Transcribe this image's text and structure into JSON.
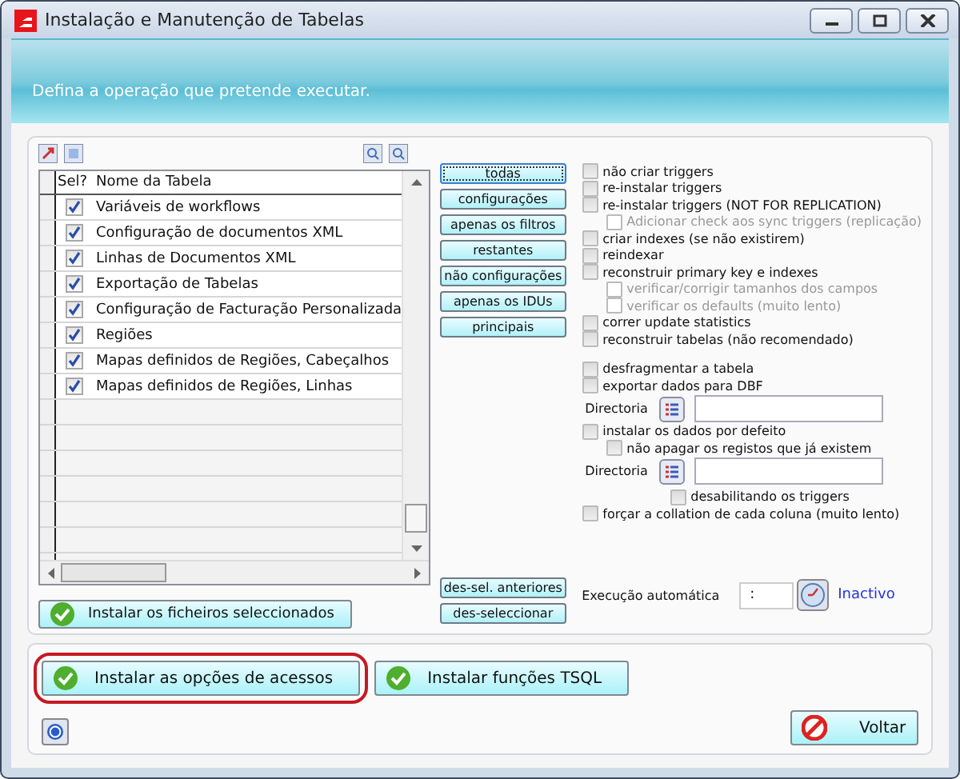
{
  "window": {
    "title": "Instalação e Manutenção de Tabelas"
  },
  "banner": {
    "text": "Defina a operação que pretende executar."
  },
  "table": {
    "columns": [
      "Sel?",
      "Nome da Tabela"
    ],
    "rows": [
      {
        "name": "Variáveis de workflows",
        "checked": true
      },
      {
        "name": "Configuração de documentos XML",
        "checked": true
      },
      {
        "name": "Linhas de Documentos XML",
        "checked": true
      },
      {
        "name": "Exportação de Tabelas",
        "checked": true
      },
      {
        "name": "Configuração de Facturação Personalizada",
        "checked": true
      },
      {
        "name": "Regiões",
        "checked": true
      },
      {
        "name": "Mapas definidos de Regiões, Cabeçalhos",
        "checked": true
      },
      {
        "name": "Mapas definidos de Regiões, Linhas",
        "checked": true
      }
    ]
  },
  "filter_buttons": [
    {
      "label": "todas",
      "focused": true
    },
    {
      "label": "configurações",
      "focused": false
    },
    {
      "label": "apenas os filtros",
      "focused": false
    },
    {
      "label": "restantes",
      "focused": false
    },
    {
      "label": "não configurações",
      "focused": false
    },
    {
      "label": "apenas os IDUs",
      "focused": false
    },
    {
      "label": "principais",
      "focused": false
    }
  ],
  "deselect_buttons": [
    "des-sel. anteriores",
    "des-seleccionar"
  ],
  "option_groups": [
    [
      {
        "kind": "check",
        "label": "não criar triggers",
        "checked": false,
        "disabled": false
      },
      {
        "kind": "check",
        "label": "re-instalar triggers",
        "checked": false,
        "disabled": false
      },
      {
        "kind": "check",
        "label": "re-instalar triggers (NOT FOR REPLICATION)",
        "checked": false,
        "disabled": false
      },
      {
        "kind": "sub",
        "label": "Adicionar check aos sync triggers (replicação)",
        "checked": false,
        "disabled": true
      },
      {
        "kind": "check",
        "label": "criar indexes (se não existirem)",
        "checked": false,
        "disabled": false
      },
      {
        "kind": "check",
        "label": "reindexar",
        "checked": false,
        "disabled": false
      },
      {
        "kind": "check",
        "label": "reconstruir primary key e indexes",
        "checked": false,
        "disabled": false
      },
      {
        "kind": "sub",
        "label": "verificar/corrigir tamanhos dos campos",
        "checked": false,
        "disabled": true
      },
      {
        "kind": "sub",
        "label": "verificar os defaults (muito lento)",
        "checked": false,
        "disabled": true
      },
      {
        "kind": "check",
        "label": "correr update statistics",
        "checked": false,
        "disabled": false
      },
      {
        "kind": "check",
        "label": "reconstruir tabelas (não recomendado)",
        "checked": false,
        "disabled": false
      }
    ],
    [
      {
        "kind": "check",
        "label": "desfragmentar a tabela",
        "checked": false,
        "disabled": false
      },
      {
        "kind": "check",
        "label": "exportar dados para DBF",
        "checked": false,
        "disabled": false
      },
      {
        "kind": "dir",
        "label": "Directoria"
      },
      {
        "kind": "check",
        "label": "instalar os dados por defeito",
        "checked": false,
        "disabled": false
      },
      {
        "kind": "sub",
        "label": "não apagar os registos que já existem",
        "checked": false,
        "disabled": false
      },
      {
        "kind": "dir",
        "label": "Directoria"
      },
      {
        "kind": "deep",
        "label": "desabilitando os triggers",
        "checked": false,
        "disabled": false
      },
      {
        "kind": "check",
        "label": "forçar a collation de cada coluna (muito lento)",
        "checked": false,
        "disabled": false
      }
    ]
  ],
  "install_button": "Instalar os ficheiros seleccionados",
  "auto_run": {
    "label": "Execução automática",
    "value": ":",
    "status": "Inactivo"
  },
  "bottom_buttons": [
    {
      "label": "Instalar as opções de acessos",
      "highlighted": true
    },
    {
      "label": "Instalar funções TSQL",
      "highlighted": false
    }
  ],
  "back_button": "Voltar"
}
